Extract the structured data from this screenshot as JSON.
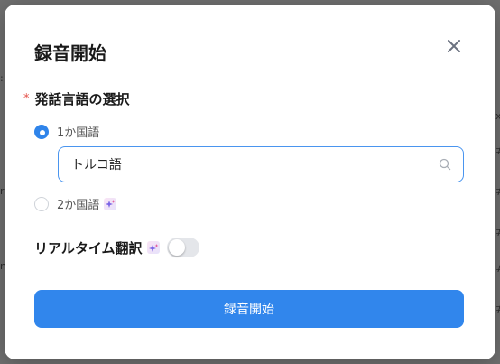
{
  "dialog": {
    "title": "録音開始",
    "close_icon": "close-icon",
    "section": {
      "required_mark": "*",
      "label": "発話言語の選択"
    },
    "options": [
      {
        "label": "1か国語",
        "selected": true
      },
      {
        "label": "2か国語",
        "selected": false,
        "badge_icon": "sparkle-icon"
      }
    ],
    "language_input": {
      "value": "トルコ語",
      "icon": "search-icon"
    },
    "realtime": {
      "label": "リアルタイム翻訳",
      "badge_icon": "sparkle-icon",
      "enabled": false
    },
    "start_button": {
      "label": "録音開始"
    },
    "colors": {
      "accent": "#3186ec",
      "required": "#e5534b",
      "badge_bg": "#f3e4f7"
    }
  }
}
